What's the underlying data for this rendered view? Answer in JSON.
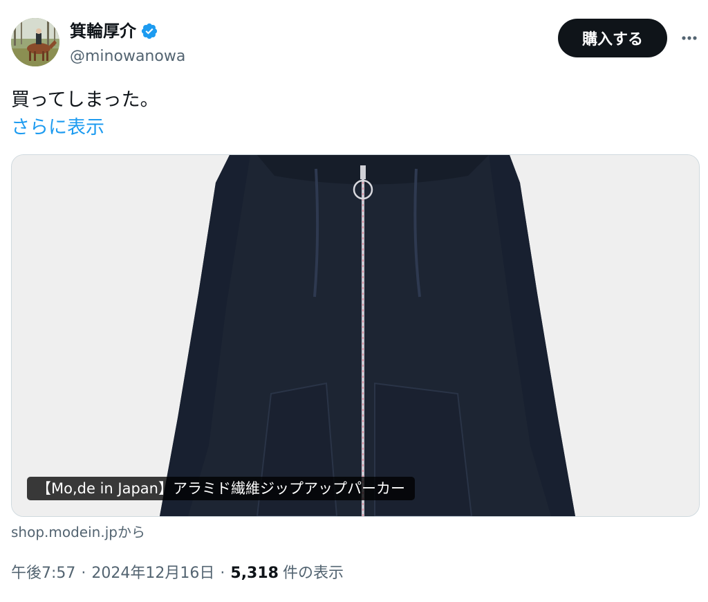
{
  "author": {
    "display_name": "箕輪厚介",
    "handle": "@minowanowa",
    "verified_icon": "verified-badge-icon",
    "verified_color": "#1d9bf0"
  },
  "actions": {
    "buy_label": "購入する",
    "more_icon": "more-dots-icon"
  },
  "tweet": {
    "text": "買ってしまった。",
    "show_more": "さらに表示"
  },
  "card": {
    "caption": "【Mo,de in Japan】アラミド繊維ジップアップパーカー",
    "source": "shop.modein.jpから"
  },
  "meta": {
    "time": "午後7:57",
    "date": "2024年12月16日",
    "views_count": "5,318",
    "views_label": "件の表示",
    "separator": "·"
  },
  "colors": {
    "accent": "#1d9bf0",
    "text_primary": "#0f1419",
    "text_secondary": "#536471",
    "hoodie": "#1d2533"
  }
}
